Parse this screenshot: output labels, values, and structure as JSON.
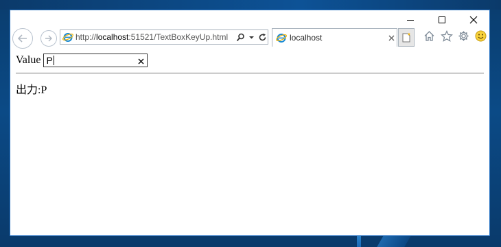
{
  "browser": {
    "address_url_prefix": "http://",
    "address_url_host": "localhost",
    "address_url_rest": ":51521/TextBoxKeyUp.html",
    "tab_title": "localhost"
  },
  "page": {
    "value_label": "Value",
    "input_value": "P",
    "output_text": "出力:P"
  },
  "icons": {
    "minimize": "minimize-icon",
    "maximize": "maximize-icon",
    "close": "close-icon",
    "back": "back-arrow-icon",
    "forward": "forward-arrow-icon",
    "search": "search-icon",
    "refresh": "refresh-icon",
    "home": "home-icon",
    "favorites": "star-icon",
    "settings": "gear-icon",
    "feedback": "smiley-icon"
  },
  "colors": {
    "window_border": "#2b74c4",
    "desktop": "#0b4a86",
    "ie_blue": "#1a8ad4",
    "ie_gold": "#f5b400"
  }
}
